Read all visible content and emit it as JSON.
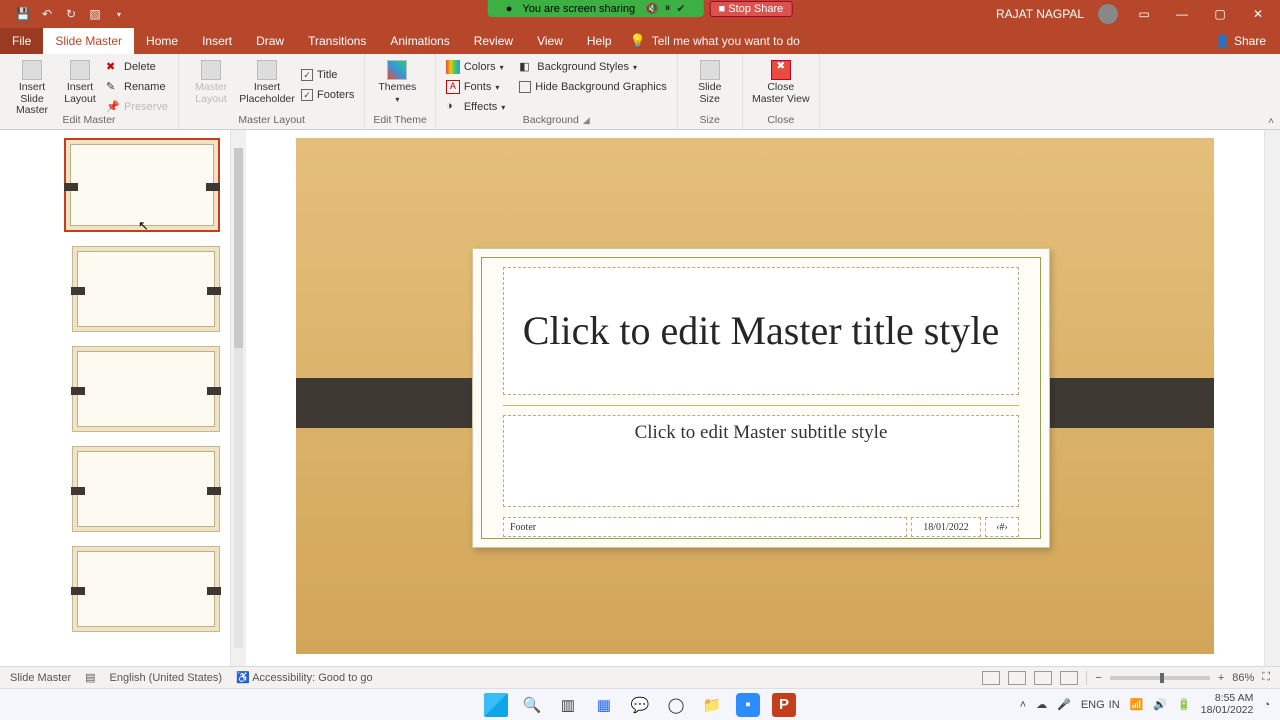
{
  "titlebar": {
    "share_msg": "You are screen sharing",
    "stop_share": "■ Stop Share",
    "user": "RAJAT NAGPAL"
  },
  "tabs": {
    "file": "File",
    "active": "Slide Master",
    "items": [
      "Home",
      "Insert",
      "Draw",
      "Transitions",
      "Animations",
      "Review",
      "View",
      "Help"
    ],
    "tell": "Tell me what you want to do",
    "share": "Share"
  },
  "ribbon": {
    "insert_slide_master": "Insert Slide\nMaster",
    "insert_layout": "Insert\nLayout",
    "delete": "Delete",
    "rename": "Rename",
    "preserve": "Preserve",
    "master_layout": "Master\nLayout",
    "insert_placeholder": "Insert\nPlaceholder",
    "title": "Title",
    "footers": "Footers",
    "themes": "Themes",
    "colors": "Colors",
    "fonts": "Fonts",
    "effects": "Effects",
    "bg_styles": "Background Styles",
    "hide_bg": "Hide Background Graphics",
    "slide_size": "Slide\nSize",
    "close_master": "Close\nMaster View",
    "g_edit_master": "Edit Master",
    "g_master_layout": "Master Layout",
    "g_edit_theme": "Edit Theme",
    "g_background": "Background",
    "g_size": "Size",
    "g_close": "Close"
  },
  "slide": {
    "title_ph": "Click to edit Master title style",
    "subtitle_ph": "Click to edit Master subtitle style",
    "footer": "Footer",
    "date": "18/01/2022",
    "num": "‹#›"
  },
  "status": {
    "view": "Slide Master",
    "lang": "English (United States)",
    "access": "Accessibility: Good to go",
    "zoom": "86%"
  },
  "system": {
    "lang1": "ENG",
    "lang2": "IN",
    "time": "8:55 AM",
    "date": "18/01/2022"
  }
}
